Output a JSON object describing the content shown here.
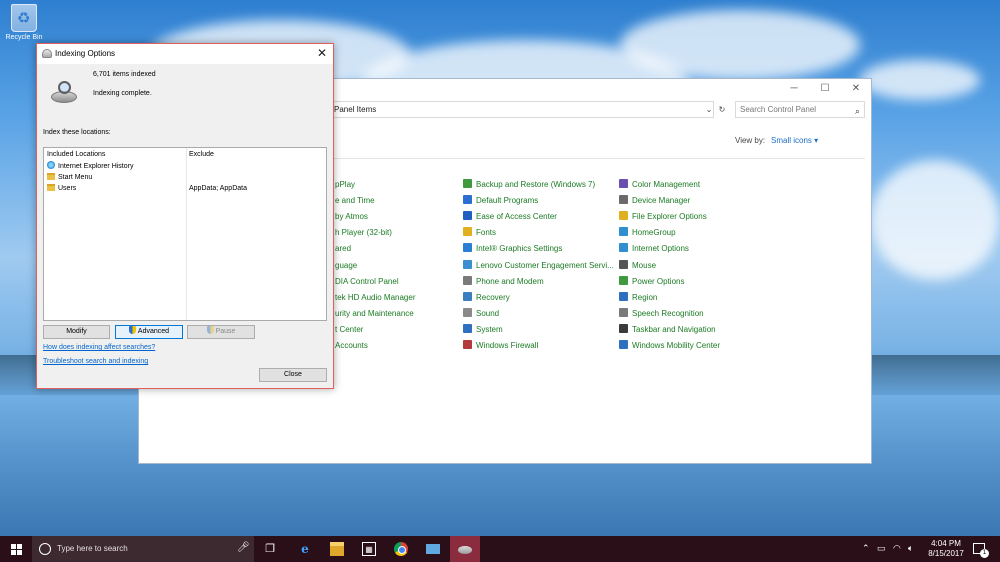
{
  "desktop": {
    "recycle_bin_label": "Recycle Bin"
  },
  "control_panel": {
    "address_text": "Panel Items",
    "search_placeholder": "Search Control Panel",
    "view_by_label": "View by:",
    "view_by_value": "Small icons ▾",
    "window_controls": {
      "minimize": "─",
      "maximize": "☐",
      "close": "✕"
    },
    "col1": [
      "pPlay",
      "e and Time",
      "by Atmos",
      "h Player (32-bit)",
      "ared",
      "guage",
      "DIA Control Panel",
      "tek HD Audio Manager",
      "urity and Maintenance",
      "t Center",
      "Accounts"
    ],
    "col2": [
      "Backup and Restore (Windows 7)",
      "Default Programs",
      "Ease of Access Center",
      "Fonts",
      "Intel® Graphics Settings",
      "Lenovo Customer Engagement Servi...",
      "Phone and Modem",
      "Recovery",
      "Sound",
      "System",
      "Windows Firewall"
    ],
    "col3": [
      "Color Management",
      "Device Manager",
      "File Explorer Options",
      "HomeGroup",
      "Internet Options",
      "Mouse",
      "Power Options",
      "Region",
      "Speech Recognition",
      "Taskbar and Navigation",
      "Windows Mobility Center"
    ],
    "icon_colors": {
      "col2": [
        "#3f9a3f",
        "#2b6fd0",
        "#1f5fbf",
        "#e0b020",
        "#2a7fd4",
        "#3a8fd0",
        "#7a7a7a",
        "#3a7fc0",
        "#8a8a8a",
        "#2f6fbf",
        "#b23a3a"
      ],
      "col3": [
        "#6a4fb0",
        "#6a6a6a",
        "#e0b020",
        "#2f8fd0",
        "#2f8fd0",
        "#555555",
        "#3f9a3f",
        "#2f6fbf",
        "#7a7a7a",
        "#3a3a3a",
        "#2f6fbf"
      ]
    }
  },
  "indexing_dialog": {
    "title": "Indexing Options",
    "close_glyph": "✕",
    "items_indexed": "6,701 items indexed",
    "status": "Indexing complete.",
    "locations_label": "Index these locations:",
    "columns": {
      "included": "Included Locations",
      "exclude": "Exclude"
    },
    "rows": [
      {
        "name": "Internet Explorer History",
        "exclude": "",
        "icon": "ie-icon"
      },
      {
        "name": "Start Menu",
        "exclude": "",
        "icon": "folder-icon"
      },
      {
        "name": "Users",
        "exclude": "AppData; AppData",
        "icon": "folder-icon"
      }
    ],
    "buttons": {
      "modify": "Modify",
      "advanced": "Advanced",
      "pause": "Pause",
      "close": "Close"
    },
    "links": {
      "how_affects": "How does indexing affect searches?",
      "troubleshoot": "Troubleshoot search and indexing"
    }
  },
  "taskbar": {
    "search_placeholder": "Type here to search",
    "time": "4:04 PM",
    "date": "8/15/2017",
    "notification_count": "1",
    "accent_color": "#8b2c3e"
  }
}
